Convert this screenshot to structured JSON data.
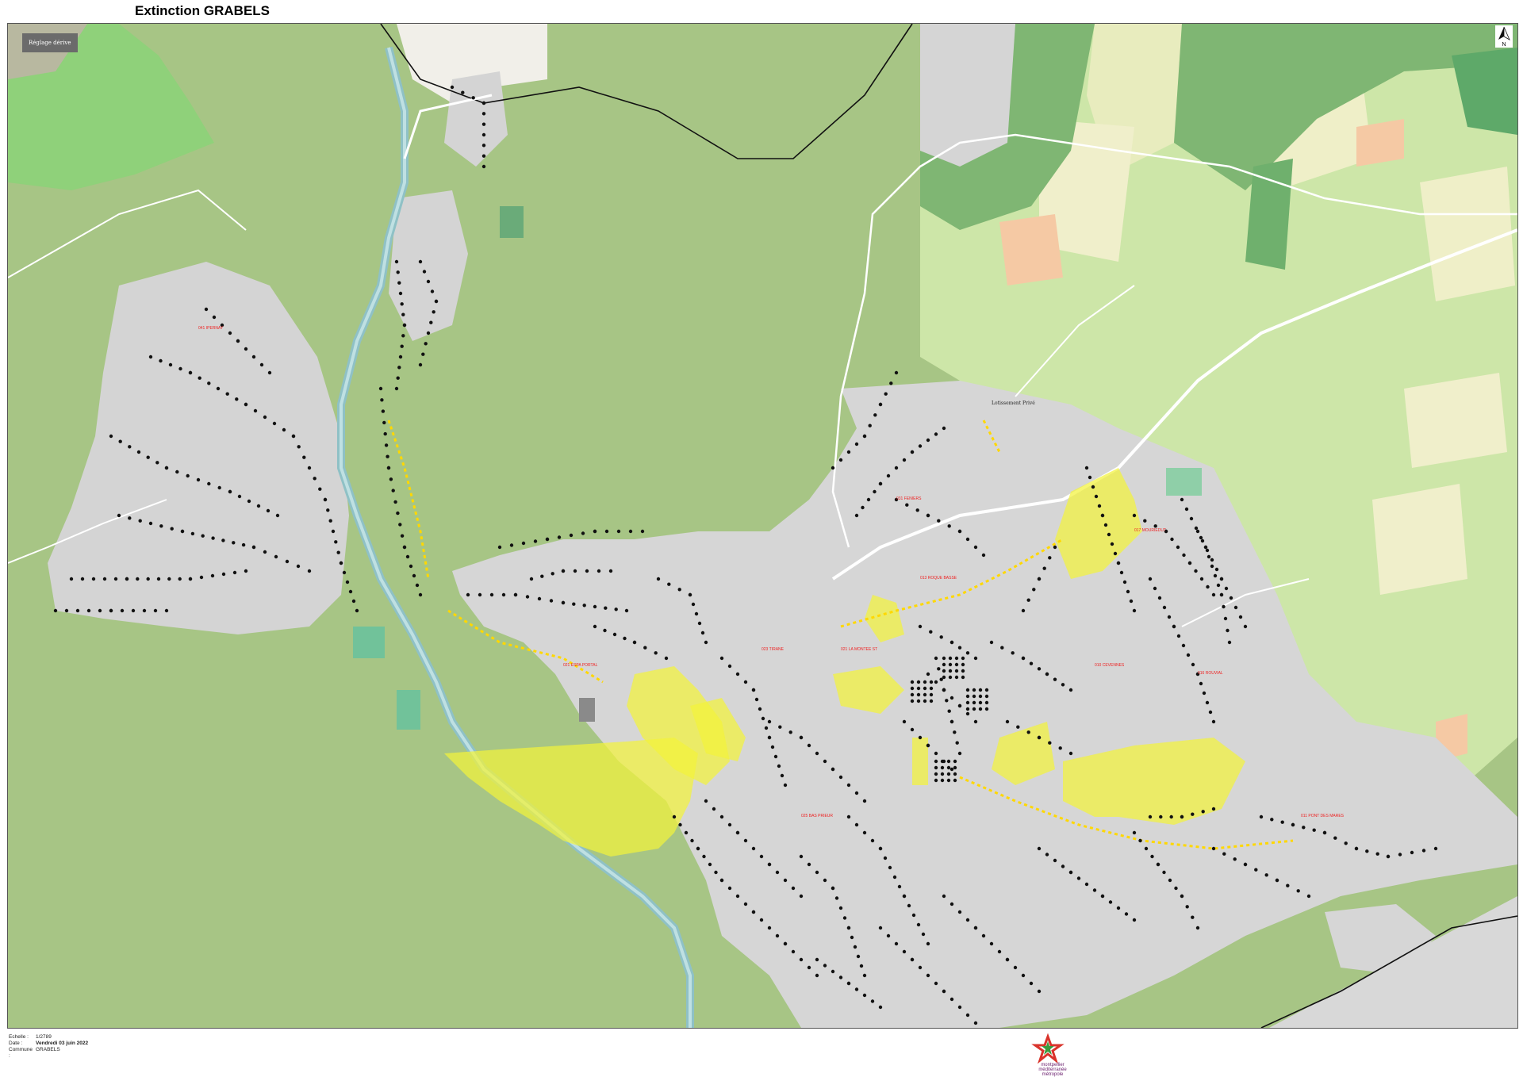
{
  "page": {
    "title": "Extinction GRABELS"
  },
  "map": {
    "badge_label": "Réglage dérive",
    "north_arrow": "N",
    "place_label": "Lotissement Privé",
    "red_labels": [
      "041 IPERNAY",
      "021 ESPA PORTAL",
      "023 TIRANE",
      "021 LA MONTEE ST",
      "013 ROQUE BASSE",
      "031 FENIERS",
      "017 MOURIEDUT",
      "010 CEVENNES",
      "016 ROUVIAL",
      "011 PONT DES MARES",
      "025 BAS PRIEUR"
    ],
    "legend_color_yellow": "#f2f23c",
    "legend_color_marker": "#111111",
    "legend_color_road_marker": "#ffd800"
  },
  "footer": {
    "echelle_label": "Echelle :",
    "echelle_value": "1/2789",
    "date_label": "Date :",
    "date_value": "Vendredi 03 juin 2022",
    "commune_label": "Commune :",
    "commune_value": "GRABELS",
    "logo_text_top": "montpellier",
    "logo_text_bottom": "méditerranée métropole"
  }
}
